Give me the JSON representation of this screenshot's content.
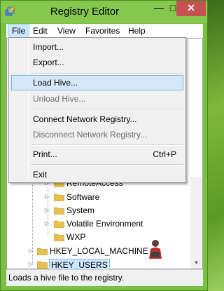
{
  "window": {
    "title": "Registry Editor",
    "minimize_glyph": "—",
    "maximize_glyph": "□",
    "close_glyph": "✕"
  },
  "menubar": {
    "items": [
      "File",
      "Edit",
      "View",
      "Favorites",
      "Help"
    ],
    "active": "File"
  },
  "file_menu": {
    "items": [
      {
        "label": "Import...",
        "enabled": true,
        "shortcut": ""
      },
      {
        "label": "Export...",
        "enabled": true,
        "shortcut": ""
      },
      {
        "label": "Load Hive...",
        "enabled": true,
        "shortcut": "",
        "highlighted": true
      },
      {
        "label": "Unload Hive...",
        "enabled": false,
        "shortcut": ""
      },
      {
        "label": "Connect Network Registry...",
        "enabled": true,
        "shortcut": ""
      },
      {
        "label": "Disconnect Network Registry...",
        "enabled": false,
        "shortcut": ""
      },
      {
        "label": "Print...",
        "enabled": true,
        "shortcut": "Ctrl+P"
      },
      {
        "label": "Exit",
        "enabled": true,
        "shortcut": ""
      }
    ]
  },
  "tree": {
    "items": [
      {
        "label": "RemoteAccess",
        "level": 3
      },
      {
        "label": "Software",
        "level": 3
      },
      {
        "label": "System",
        "level": 3
      },
      {
        "label": "Volatile Environment",
        "level": 3
      },
      {
        "label": "WXP",
        "level": 3
      },
      {
        "label": "HKEY_LOCAL_MACHINE",
        "level": 1
      },
      {
        "label": "HKEY_USERS",
        "level": 1,
        "selected": true
      }
    ]
  },
  "status": {
    "text": "Loads a hive file to the registry."
  },
  "colors": {
    "title_bar": "#86c94e",
    "close_button": "#c75050",
    "menu_highlight": "#d5e8f7",
    "folder": "#e8c050"
  },
  "icons": {
    "app": "registry-editor-icon",
    "folder": "folder-icon",
    "expander": "expander-triangle-icon",
    "scroll_down": "scroll-down-arrow-icon",
    "watermark": "person-with-laptop-icon"
  }
}
